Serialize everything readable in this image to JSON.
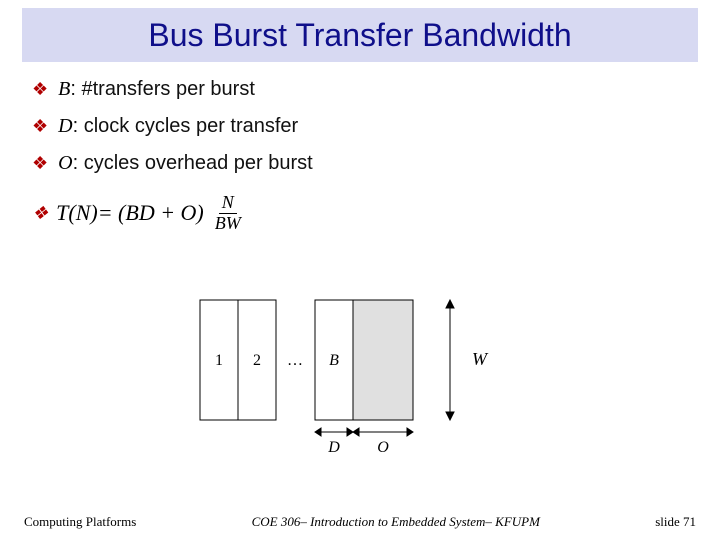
{
  "title": "Bus Burst Transfer Bandwidth",
  "bullets": [
    {
      "var": "B",
      "def": ": #transfers per burst"
    },
    {
      "var": "D",
      "def": ": clock cycles per transfer"
    },
    {
      "var": "O",
      "def": ": cycles overhead per burst"
    }
  ],
  "formula": {
    "lhs": "T(N)",
    "mid": " = (BD + O) ",
    "frac_num": "N",
    "frac_den": "BW"
  },
  "diagram": {
    "cols": [
      "1",
      "2",
      "…",
      "B"
    ],
    "d_label": "D",
    "o_label": "O",
    "w_label": "W"
  },
  "footer": {
    "left": "Computing Platforms",
    "center": "COE 306– Introduction to Embedded System– KFUPM",
    "right": "slide 71"
  }
}
